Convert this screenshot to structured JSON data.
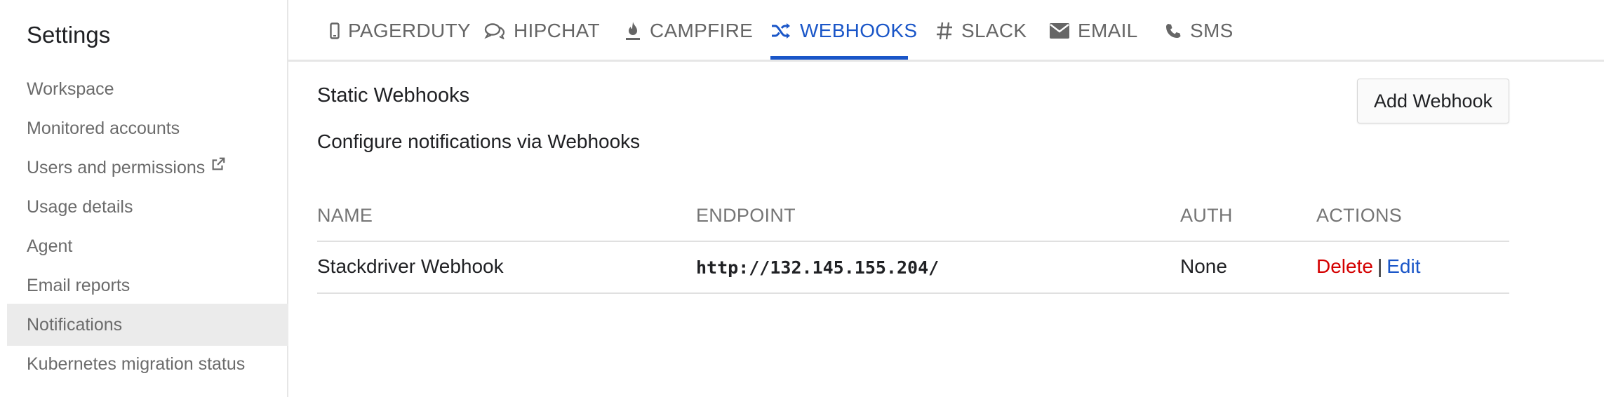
{
  "sidebar": {
    "title": "Settings",
    "items": [
      {
        "label": "Workspace"
      },
      {
        "label": "Monitored accounts"
      },
      {
        "label": "Users and permissions",
        "icon": "external-link-icon"
      },
      {
        "label": "Usage details"
      },
      {
        "label": "Agent"
      },
      {
        "label": "Email reports"
      },
      {
        "label": "Notifications",
        "active": true
      },
      {
        "label": "Kubernetes migration status"
      }
    ]
  },
  "tabs": [
    {
      "label": "PAGERDUTY",
      "icon": "mobile-phone-icon"
    },
    {
      "label": "HIPCHAT",
      "icon": "chat-bubbles-icon"
    },
    {
      "label": "CAMPFIRE",
      "icon": "fire-icon"
    },
    {
      "label": "WEBHOOKS",
      "icon": "shuffle-icon",
      "active": true
    },
    {
      "label": "SLACK",
      "icon": "hash-icon"
    },
    {
      "label": "EMAIL",
      "icon": "envelope-icon"
    },
    {
      "label": "SMS",
      "icon": "phone-icon"
    }
  ],
  "main": {
    "title": "Static Webhooks",
    "description": "Configure notifications via Webhooks",
    "add_button": "Add Webhook",
    "table": {
      "headers": [
        "NAME",
        "ENDPOINT",
        "AUTH",
        "ACTIONS"
      ],
      "rows": [
        {
          "name": "Stackdriver Webhook",
          "endpoint": "http://132.145.155.204/",
          "auth": "None",
          "actions": {
            "delete": "Delete",
            "separator": "|",
            "edit": "Edit"
          }
        }
      ]
    }
  },
  "colors": {
    "accent": "#1a56c8",
    "danger": "#d40000",
    "active_bg": "#ebebeb"
  }
}
